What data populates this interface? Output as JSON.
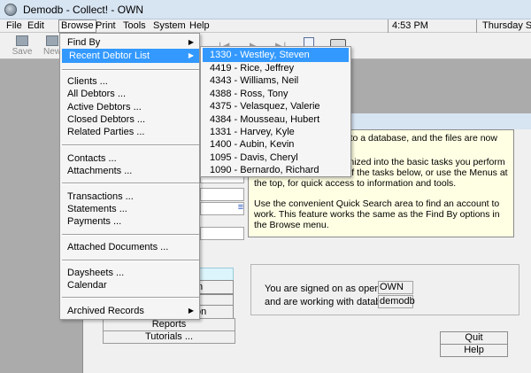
{
  "window": {
    "title": "Demodb - Collect! - OWN"
  },
  "menubar": {
    "items": [
      "File",
      "Edit",
      "Browse",
      "Print",
      "Tools",
      "System",
      "Help"
    ],
    "time": "4:53 PM",
    "date": "Thursday Sep"
  },
  "toolbar": {
    "save_label": "Save",
    "new_label": "New"
  },
  "browse_menu": {
    "find_by": "Find By",
    "recent_debtor_list": "Recent Debtor List",
    "clients": "Clients ...",
    "all_debtors": "All Debtors ...",
    "active_debtors": "Active Debtors ...",
    "closed_debtors": "Closed Debtors ...",
    "related_parties": "Related Parties ...",
    "contacts": "Contacts ...",
    "attachments": "Attachments ...",
    "transactions": "Transactions ...",
    "statements": "Statements ...",
    "payments": "Payments ...",
    "attached_documents": "Attached Documents ...",
    "daysheets": "Daysheets ...",
    "calendar": "Calendar",
    "archived_records": "Archived Records"
  },
  "recent_debtors": [
    "1330 - Westley, Steven",
    "4419 - Rice, Jeffrey",
    "4343 - Williams, Neil",
    "4388 - Ross, Tony",
    "4375 - Velasquez, Valerie",
    "4384 - Mousseau, Hubert",
    "1331 - Harvey, Kyle",
    "1400 - Aubin, Kevin",
    "1095 - Davis, Cheryl",
    "1090 - Bernardo, Richard"
  ],
  "info_box": {
    "line1": "on to a database, and the files are now",
    "line2": "The main menu is organized into the basic tasks you perform in Collect!. Select one of the tasks below, or use the Menus at the top, for quick access to information and tools.",
    "line3": "Use the convenient Quick Search area to find an account to work. This feature works the same as the Find By options in the Browse menu."
  },
  "side_buttons": {
    "b1": "n",
    "b2": "on"
  },
  "main_buttons": {
    "reports": "Reports",
    "tutorials": "Tutorials ..."
  },
  "operator": {
    "signed_on_label": "You are signed on as operator",
    "signed_on_value": "OWN",
    "database_label": "and are working with database",
    "database_value": "demodb"
  },
  "system_buttons": {
    "quit": "Quit",
    "help": "Help"
  }
}
